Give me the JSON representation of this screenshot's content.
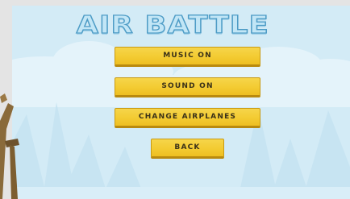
{
  "menu": {
    "title": "AIR BATTLE",
    "buttons": {
      "music": "MUSIC ON",
      "sound": "SOUND ON",
      "change_airplanes": "CHANGE AIRPLANES",
      "back": "BACK"
    }
  },
  "colors": {
    "sky": "#d3ebf6",
    "button_fill": "#f3cb32",
    "button_text": "#3a3118",
    "title_fill": "#c2e6f6",
    "title_outline": "#4e9cc6"
  }
}
